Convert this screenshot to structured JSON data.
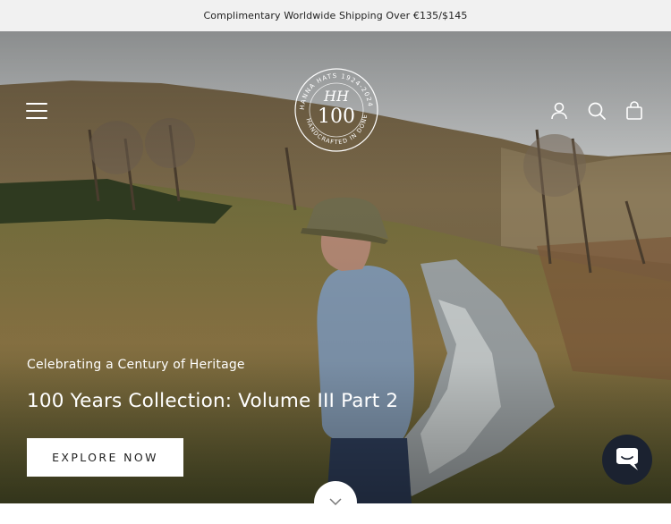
{
  "announcement": {
    "text": "Complimentary Worldwide Shipping Over €135/$145"
  },
  "header": {
    "logo_text": "100",
    "logo_ring_text": "HANNA HATS 1924-2024 · HANDCRAFTED IN DONEGAL",
    "icons": [
      "menu-icon",
      "account-icon",
      "search-icon",
      "cart-icon"
    ]
  },
  "hero": {
    "subtitle": "Celebrating a Century of Heritage",
    "title": "100 Years Collection: Volume III Part 2",
    "cta_label": "EXPLORE NOW"
  },
  "colors": {
    "announcement_bg": "#f1f1f1",
    "chat_bg": "#1b2230",
    "cta_bg": "#ffffff"
  }
}
